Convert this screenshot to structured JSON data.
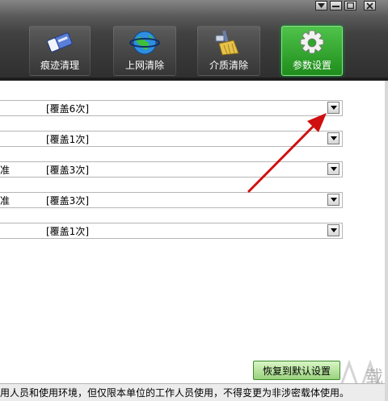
{
  "tabs": [
    {
      "key": "clean",
      "label": "痕迹清理",
      "icon": "eraser-icon"
    },
    {
      "key": "internet",
      "label": "上网清除",
      "icon": "globe-icon"
    },
    {
      "key": "media",
      "label": "介质清除",
      "icon": "broom-icon"
    },
    {
      "key": "settings",
      "label": "参数设置",
      "icon": "gear-icon",
      "active": true
    }
  ],
  "rows": [
    {
      "prefix": "",
      "value": "[覆盖6次]"
    },
    {
      "prefix": "",
      "value": "[覆盖1次]"
    },
    {
      "prefix": "准",
      "value": "[覆盖3次]"
    },
    {
      "prefix": "准",
      "value": "[覆盖3次]"
    },
    {
      "prefix": "",
      "value": "[覆盖1次]"
    }
  ],
  "restore_button": "恢复到默认设置",
  "status_text": "用人员和使用环境，但仅限本单位的工作人员使用，不得变更为非涉密载体使用。",
  "watermark": "载",
  "colors": {
    "active_tab": "#2fa52b",
    "header": "#3a3a3a",
    "annotation_arrow": "#d01010",
    "restore_button": "#9ad27e"
  }
}
